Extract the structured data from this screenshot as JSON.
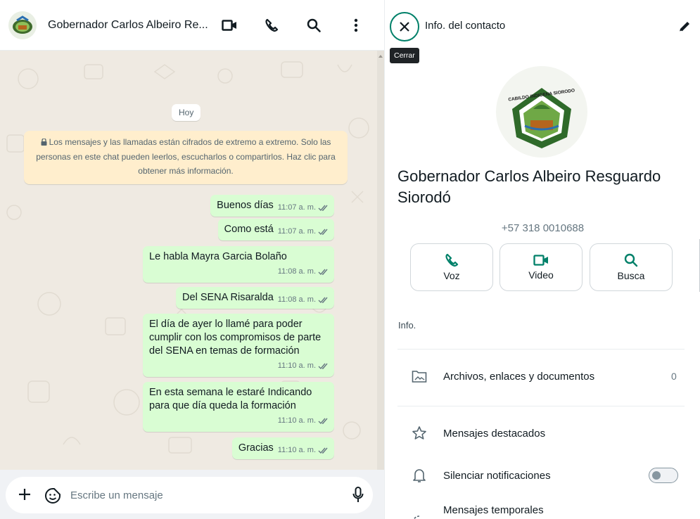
{
  "chat": {
    "title": "Gobernador Carlos Albeiro Re...",
    "day_label": "Hoy",
    "encryption_note": "Los mensajes y las llamadas están cifrados de extremo a extremo. Solo las personas en este chat pueden leerlos, escucharlos o compartirlos. Haz clic para obtener más información.",
    "messages": [
      {
        "text": "Buenos días",
        "time": "11:07 a. m."
      },
      {
        "text": "Como está",
        "time": "11:07 a. m."
      },
      {
        "text": "Le habla Mayra Garcia Bolaño",
        "time": "11:08 a. m."
      },
      {
        "text": "Del SENA Risaralda",
        "time": "11:08 a. m."
      },
      {
        "text": "El día de ayer lo llamé para poder cumplir con los compromisos de parte del SENA en temas de formación",
        "time": "11:10 a. m."
      },
      {
        "text": "En esta semana le estaré Indicando para que día queda la formación",
        "time": "11:10 a. m."
      },
      {
        "text": "Gracias",
        "time": "11:10 a. m."
      }
    ],
    "composer": {
      "placeholder": "Escribe un mensaje"
    }
  },
  "info": {
    "title": "Info. del contacto",
    "close_tooltip": "Cerrar",
    "avatar_text": "CABILDO INDIGENA SIORODO",
    "name": "Gobernador Carlos Albeiro Resguardo Siorodó",
    "phone": "+57 318 0010688",
    "actions": [
      {
        "label": "Voz",
        "icon": "phone-icon"
      },
      {
        "label": "Video",
        "icon": "video-icon"
      },
      {
        "label": "Busca",
        "icon": "search-icon"
      }
    ],
    "info_label": "Info.",
    "rows": {
      "files": {
        "label": "Archivos, enlaces y documentos",
        "count": "0"
      },
      "starred": {
        "label": "Mensajes destacados"
      },
      "mute": {
        "label": "Silenciar notificaciones"
      },
      "temporary": {
        "label": "Mensajes temporales"
      }
    }
  },
  "colors": {
    "accent": "#008069",
    "outgoing_bubble": "#d9fdd3",
    "chat_background": "#efeae2",
    "encryption_note_bg": "#ffeecd"
  }
}
